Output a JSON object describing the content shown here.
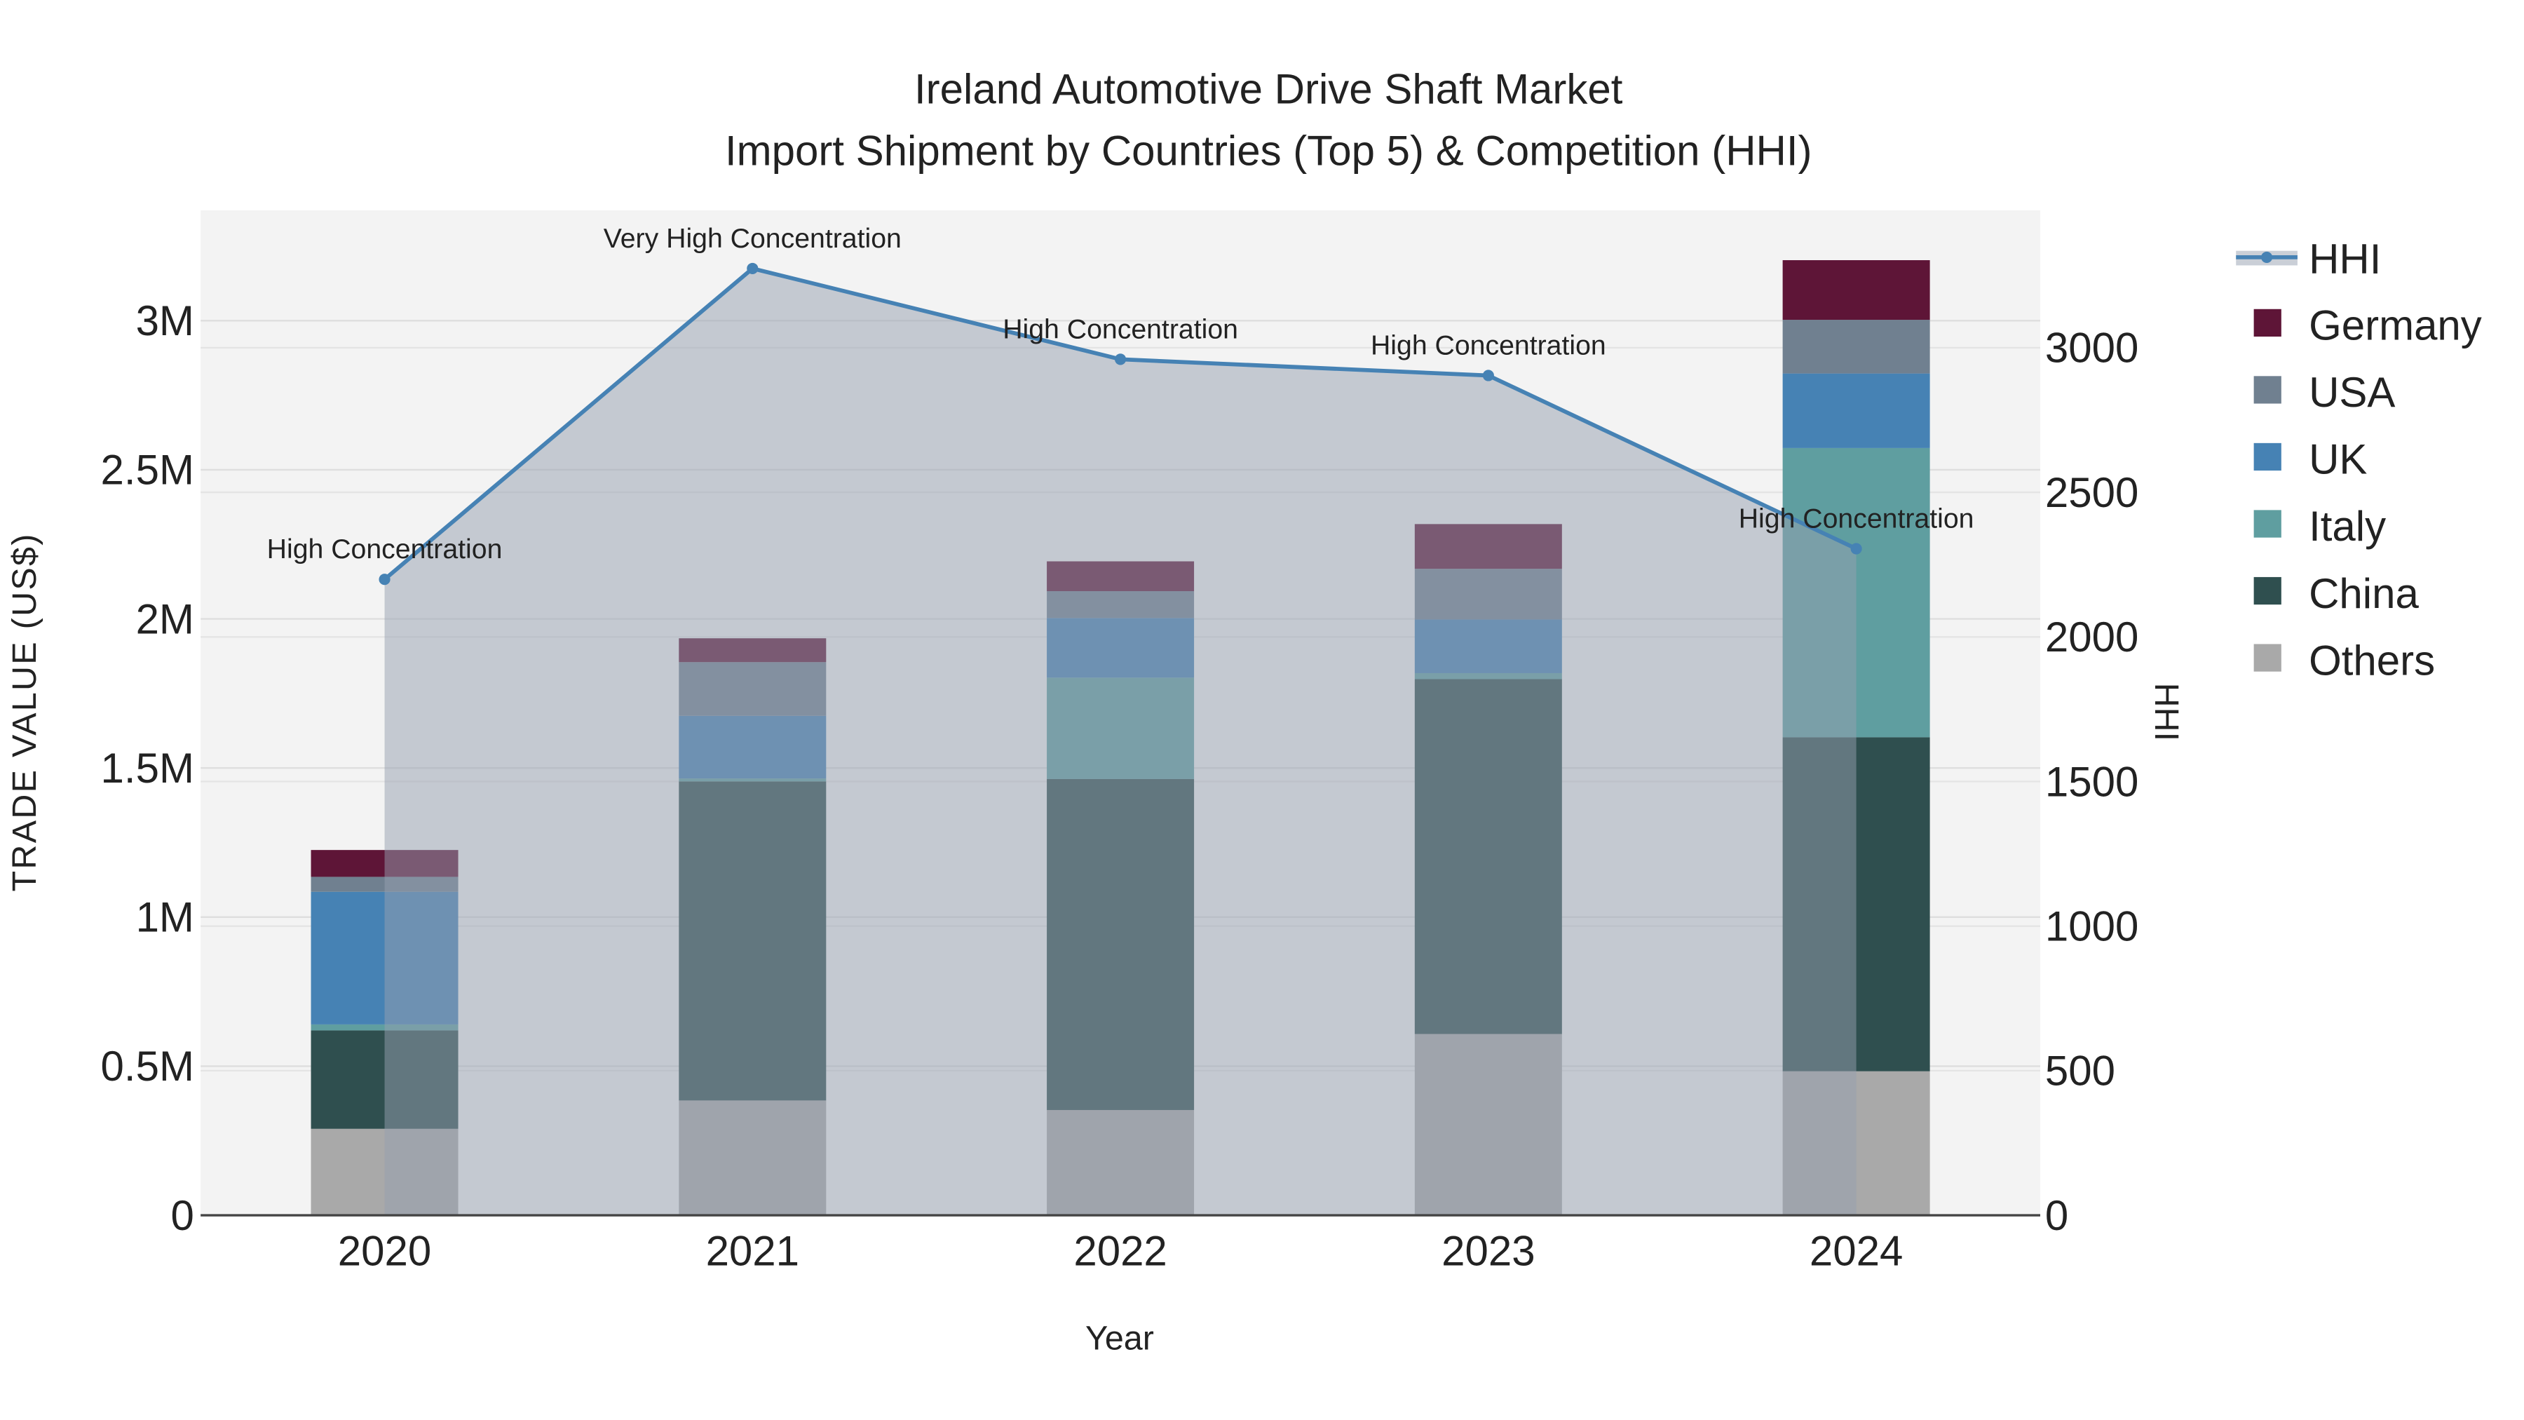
{
  "chart_data": {
    "type": "bar",
    "stacked": true,
    "title": "Ireland Automotive Drive Shaft Market",
    "subtitle": "Import Shipment by Countries (Top 5) & Competition (HHI)",
    "xlabel": "Year",
    "ylabel": "TRADE VALUE (US$)",
    "y2label": "HHI",
    "categories": [
      "2020",
      "2021",
      "2022",
      "2023",
      "2024"
    ],
    "ylim": [
      0,
      3370000
    ],
    "y2lim": [
      0,
      3475
    ],
    "yticks": [
      {
        "v": 0,
        "label": "0"
      },
      {
        "v": 500000,
        "label": "0.5M"
      },
      {
        "v": 1000000,
        "label": "1M"
      },
      {
        "v": 1500000,
        "label": "1.5M"
      },
      {
        "v": 2000000,
        "label": "2M"
      },
      {
        "v": 2500000,
        "label": "2.5M"
      },
      {
        "v": 3000000,
        "label": "3M"
      }
    ],
    "y2ticks": [
      {
        "v": 0,
        "label": "0"
      },
      {
        "v": 500,
        "label": "500"
      },
      {
        "v": 1000,
        "label": "1000"
      },
      {
        "v": 1500,
        "label": "1500"
      },
      {
        "v": 2000,
        "label": "2000"
      },
      {
        "v": 2500,
        "label": "2500"
      },
      {
        "v": 3000,
        "label": "3000"
      }
    ],
    "grid": true,
    "legend_position": "right",
    "series": [
      {
        "name": "Others",
        "color": "#a9a9a9",
        "values": [
          290000,
          385000,
          353000,
          608000,
          483000
        ]
      },
      {
        "name": "China",
        "color": "#2f4f4f",
        "values": [
          330000,
          1070000,
          1110000,
          1190000,
          1120000
        ]
      },
      {
        "name": "Italy",
        "color": "#5f9ea0",
        "values": [
          20000,
          10000,
          340000,
          20000,
          970000
        ]
      },
      {
        "name": "UK",
        "color": "#4682b4",
        "values": [
          445000,
          210000,
          200000,
          180000,
          250000
        ]
      },
      {
        "name": "USA",
        "color": "#708090",
        "values": [
          50000,
          180000,
          90000,
          170000,
          180000
        ]
      },
      {
        "name": "Germany",
        "color": "#5e1537",
        "values": [
          90000,
          80000,
          100000,
          150000,
          200000
        ]
      }
    ],
    "hhi": {
      "name": "HHI",
      "color": "#4682b4",
      "values": [
        2199,
        3274,
        2960,
        2904,
        2305
      ],
      "annotations": [
        "High Concentration",
        "Very High Concentration",
        "High Concentration",
        "High Concentration",
        "High Concentration"
      ]
    },
    "legend": [
      "HHI",
      "Germany",
      "USA",
      "UK",
      "Italy",
      "China",
      "Others"
    ]
  }
}
